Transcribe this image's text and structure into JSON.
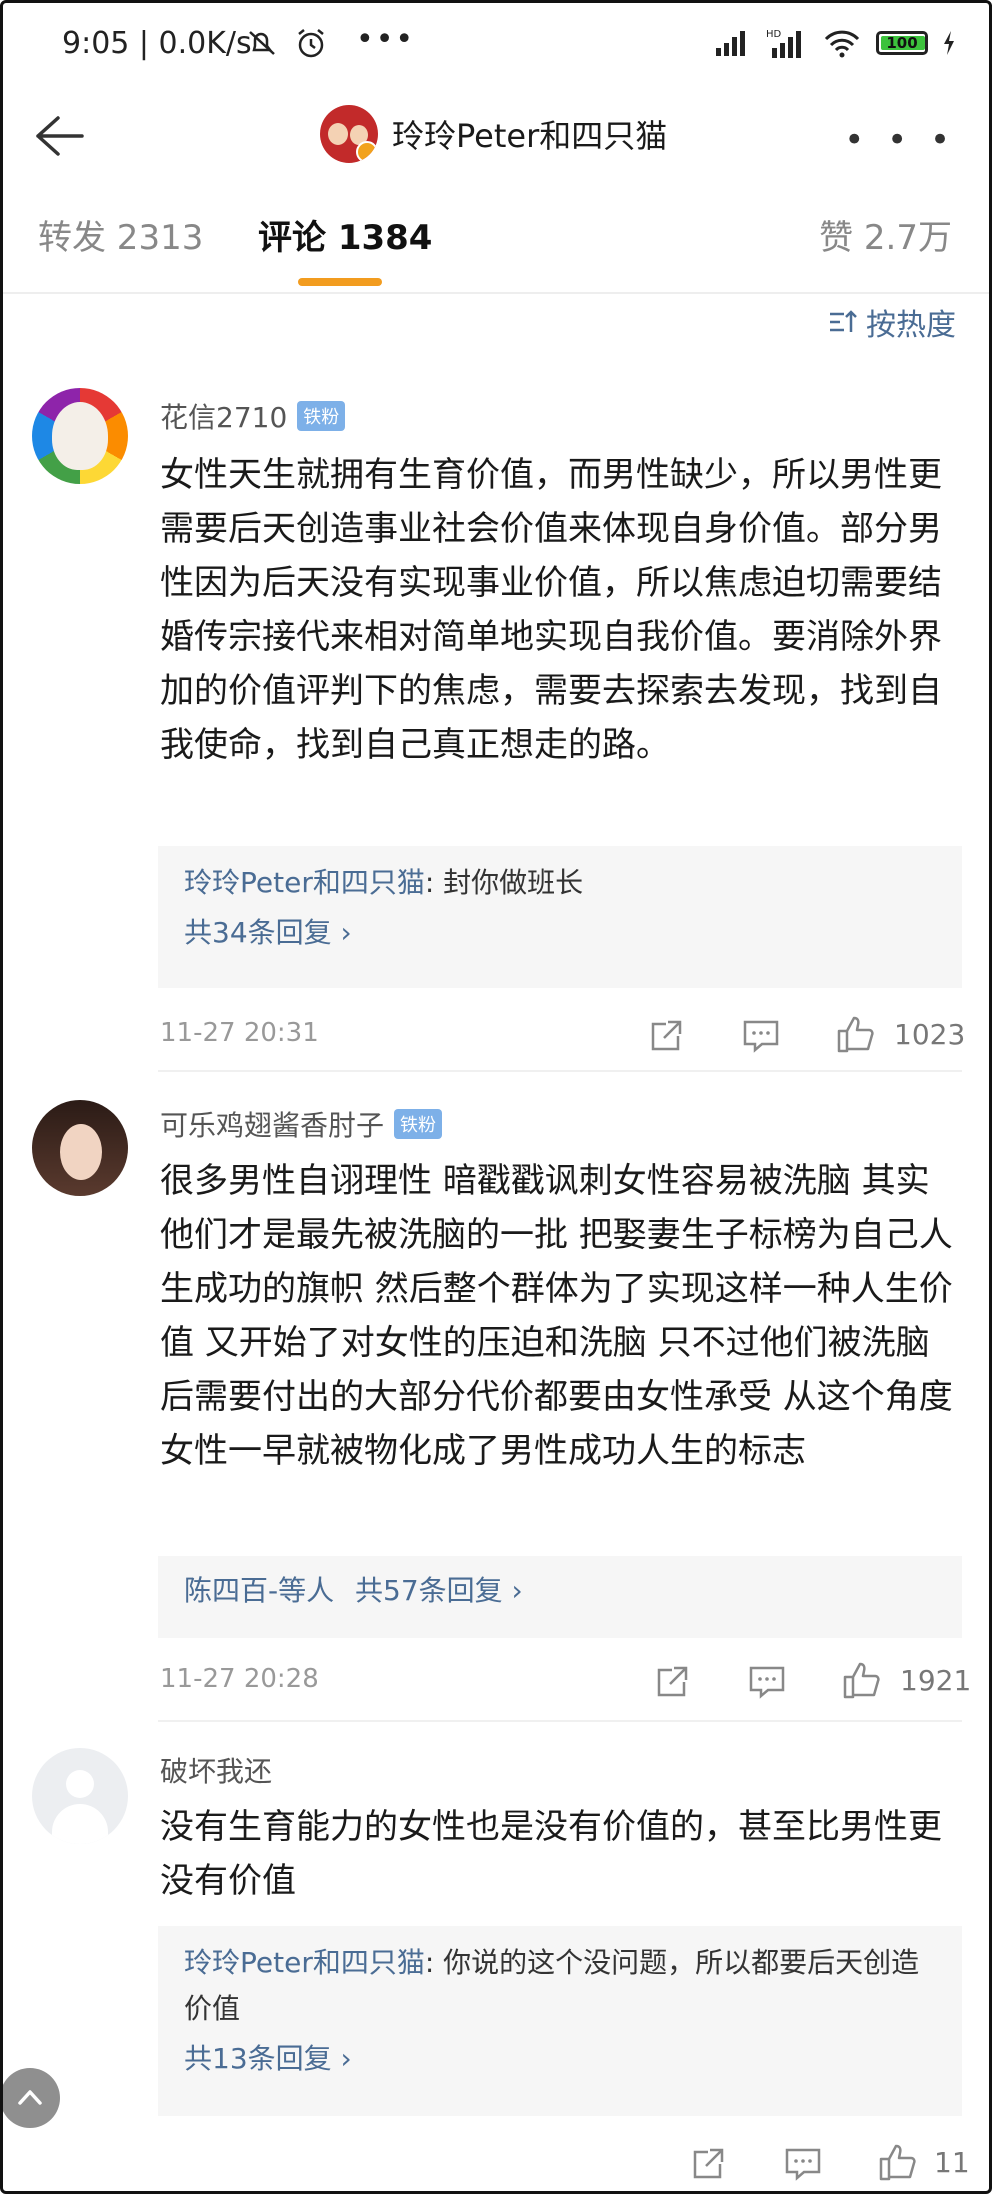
{
  "status_bar": {
    "time_net": "9:05 | 0.0K/s",
    "more": "•••",
    "battery": "100",
    "icons": [
      "mute-icon",
      "alarm-icon",
      "signal-icon",
      "hd-signal-icon",
      "wifi-icon",
      "battery-icon",
      "charging-icon"
    ]
  },
  "nav": {
    "title": "玲玲Peter和四只猫",
    "back_icon": "back-arrow-icon",
    "more_icon": "more-icon",
    "more": "• • •"
  },
  "tabs": {
    "repost": "转发 2313",
    "comments": "评论 1384",
    "likes": "赞 2.7万",
    "active_color": "#f29c1f"
  },
  "sort": {
    "label": "按热度",
    "icon": "sort-icon"
  },
  "comments": [
    {
      "user": "花信2710",
      "badge": "铁粉",
      "text": "女性天生就拥有生育价值，而男性缺少，所以男性更需要后天创造事业社会价值来体现自身价值。部分男性因为后天没有实现事业价值，所以焦虑迫切需要结婚传宗接代来相对简单地实现自我价值。要消除外界加的价值评判下的焦虑，需要去探索去发现，找到自我使命，找到自己真正想走的路。",
      "reply_name": "玲玲Peter和四只猫",
      "reply_text": ": 封你做班长",
      "reply_count": "共34条回复 ›",
      "time": "11-27 20:31",
      "likes": "1023"
    },
    {
      "user": "可乐鸡翅酱香肘子",
      "badge": "铁粉",
      "text": "很多男性自诩理性 暗戳戳讽刺女性容易被洗脑 其实他们才是最先被洗脑的一批 把娶妻生子标榜为自己人生成功的旗帜 然后整个群体为了实现这样一种人生价值 又开始了对女性的压迫和洗脑 只不过他们被洗脑后需要付出的大部分代价都要由女性承受 从这个角度女性一早就被物化成了男性成功人生的标志",
      "reply_name": "陈四百-等人",
      "reply_count": "共57条回复 ›",
      "time": "11-27 20:28",
      "likes": "1921"
    },
    {
      "user": "破坏我还",
      "text": "没有生育能力的女性也是没有价值的，甚至比男性更没有价值",
      "reply_name": "玲玲Peter和四只猫",
      "reply_text": ": 你说的这个没问题，所以都要后天创造价值",
      "reply_count": "共13条回复 ›",
      "likes": "11"
    }
  ]
}
